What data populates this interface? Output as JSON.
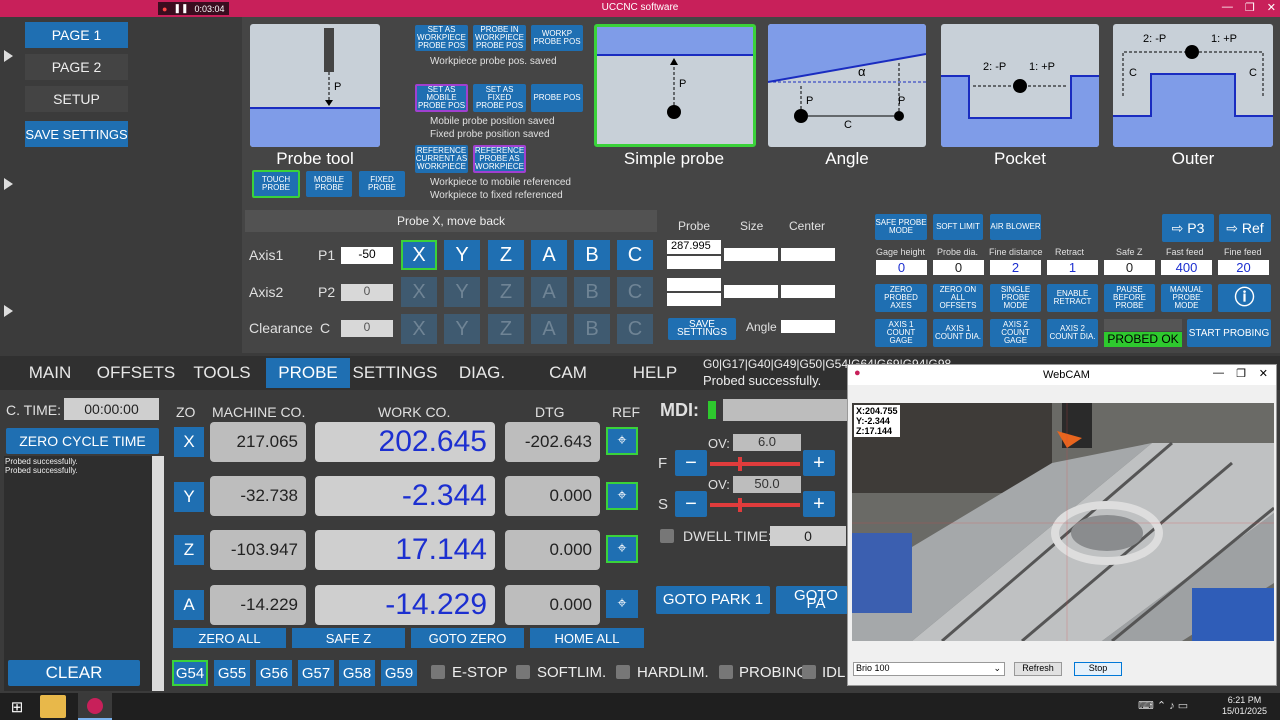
{
  "window": {
    "title": "UCCNC software",
    "rec_time": "0:03:04"
  },
  "nav": {
    "page1": "PAGE 1",
    "page2": "PAGE 2",
    "setup": "SETUP",
    "save": "SAVE SETTINGS"
  },
  "probe_tool": {
    "btn1": "SET AS WORKPIECE PROBE POS",
    "btn2": "PROBE IN WORKPIECE PROBE POS",
    "btn3": "WORKP PROBE POS",
    "msg1": "Workpiece probe pos. saved",
    "btn4": "SET AS MOBILE PROBE POS",
    "btn5": "SET AS FIXED PROBE POS",
    "btn6": "PROBE POS",
    "msg2": "Mobile probe position saved",
    "msg3": "Fixed probe position saved",
    "btn7": "REFERENCE CURRENT AS WORKPIECE",
    "btn8": "REFERENCE PROBE AS WORKPIECE",
    "msg4": "Workpiece to mobile referenced",
    "msg5": "Workpiece to fixed referenced",
    "touch": "TOUCH PROBE",
    "mobile": "MOBILE PROBE",
    "fixed": "FIXED PROBE"
  },
  "cards": {
    "probe_tool": "Probe tool",
    "simple": "Simple probe",
    "angle": "Angle",
    "pocket": "Pocket",
    "outer": "Outer",
    "p": "P",
    "c": "C",
    "alpha": "α",
    "m_p": "2: -P",
    "p_p": "1: +P"
  },
  "probe_panel": {
    "status": "Probe X, move back",
    "axis1": "Axis1",
    "axis2": "Axis2",
    "clearance": "Clearance",
    "p1": "P1",
    "p2": "P2",
    "c": "C",
    "p1_val": "-50",
    "p2_val": "0",
    "c_val": "0",
    "axes": [
      "X",
      "Y",
      "Z",
      "A",
      "B",
      "C"
    ],
    "h_probe": "Probe",
    "h_size": "Size",
    "h_center": "Center",
    "probe_val": "287.995",
    "save": "SAVE SETTINGS",
    "angle": "Angle"
  },
  "right_panel": {
    "safe": "SAFE PROBE MODE",
    "soft": "SOFT LIMIT",
    "air": "AIR BLOWER",
    "p3": "P3",
    "ref": "Ref",
    "labels": [
      "Gage height",
      "Probe dia.",
      "Fine distance",
      "Retract",
      "Safe Z",
      "Fast feed",
      "Fine feed"
    ],
    "values": [
      "0",
      "0",
      "2",
      "1",
      "0",
      "400",
      "20"
    ],
    "b1": "ZERO PROBED AXES",
    "b2": "ZERO ON ALL OFFSETS",
    "b3": "SINGLE PROBE MODE",
    "b4": "ENABLE RETRACT",
    "b5": "PAUSE BEFORE PROBE",
    "b6": "MANUAL PROBE MODE",
    "b7": "AXIS 1 COUNT GAGE",
    "b8": "AXIS 1 COUNT DIA.",
    "b9": "AXIS 2 COUNT GAGE",
    "b10": "AXIS 2 COUNT DIA.",
    "probed_ok": "PROBED OK",
    "start": "START PROBING"
  },
  "tabs": [
    "MAIN",
    "OFFSETS",
    "TOOLS",
    "PROBE",
    "SETTINGS",
    "DIAG.",
    "CAM",
    "HELP"
  ],
  "gcode": {
    "line": "G0|G17|G40|G49|G50|G54|G64|G69|G94|G98",
    "status": "Probed successfully."
  },
  "left": {
    "ctime_label": "C. TIME:",
    "ctime": "00:00:00",
    "zero_cycle": "ZERO CYCLE TIME",
    "log": [
      "Probed successfully.",
      "Probed successfully."
    ],
    "clear": "CLEAR"
  },
  "dro": {
    "h_zo": "ZO",
    "h_machine": "MACHINE CO.",
    "h_work": "WORK CO.",
    "h_dtg": "DTG",
    "h_ref": "REF",
    "rows": [
      {
        "axis": "X",
        "machine": "217.065",
        "work": "202.645",
        "dtg": "-202.643"
      },
      {
        "axis": "Y",
        "machine": "-32.738",
        "work": "-2.344",
        "dtg": "0.000"
      },
      {
        "axis": "Z",
        "machine": "-103.947",
        "work": "17.144",
        "dtg": "0.000"
      },
      {
        "axis": "A",
        "machine": "-14.229",
        "work": "-14.229",
        "dtg": "0.000"
      }
    ],
    "zero_all": "ZERO ALL",
    "safe_z": "SAFE Z",
    "goto_zero": "GOTO ZERO",
    "home_all": "HOME ALL"
  },
  "feed": {
    "mdi": "MDI:",
    "ov": "OV:",
    "f_ov": "6.0",
    "s_ov": "50.0",
    "f": "F",
    "s": "S",
    "dwell": "DWELL TIME:",
    "dwell_val": "0",
    "park1": "GOTO PARK 1",
    "park2": "GOTO PA"
  },
  "gcodes": [
    "G54",
    "G55",
    "G56",
    "G57",
    "G58",
    "G59"
  ],
  "status": {
    "estop": "E-STOP",
    "softlim": "SOFTLIM.",
    "hardlim": "HARDLIM.",
    "probing": "PROBING",
    "idle": "IDL"
  },
  "webcam": {
    "title": "WebCAM",
    "x": "X:204.755",
    "y": "Y:-2.344",
    "z": "Z:17.144",
    "camera": "Brio 100",
    "refresh": "Refresh",
    "stop": "Stop"
  },
  "taskbar": {
    "time": "6:21 PM",
    "date": "15/01/2025"
  }
}
